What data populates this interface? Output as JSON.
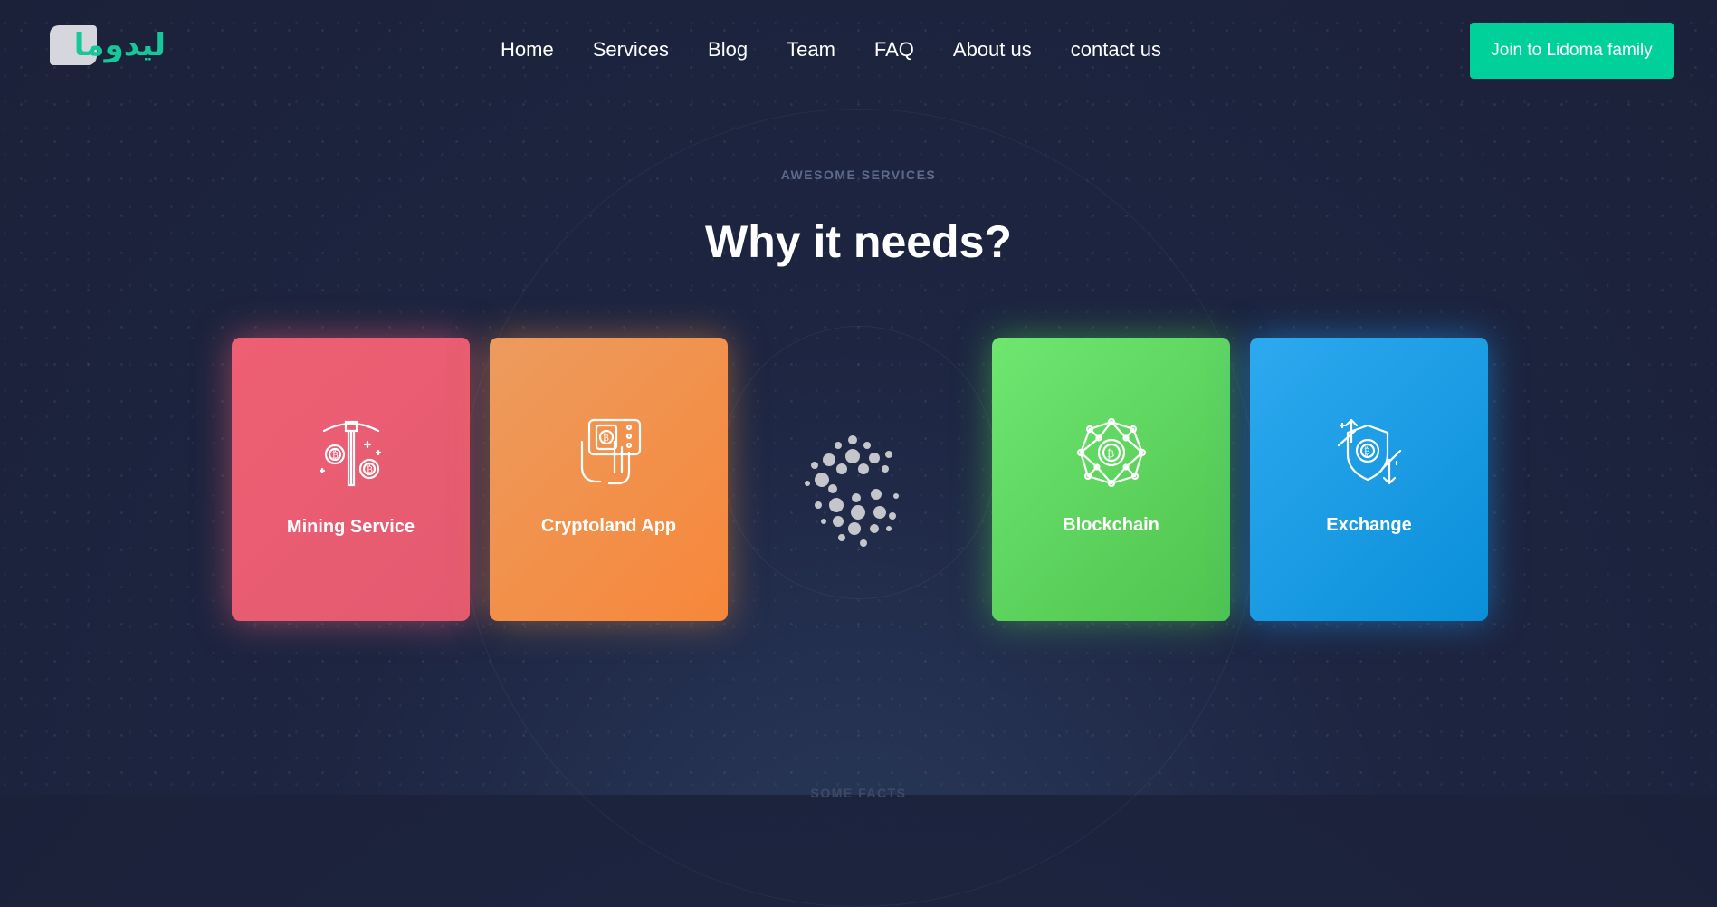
{
  "header": {
    "logo_text": "ليدوما",
    "nav": [
      "Home",
      "Services",
      "Blog",
      "Team",
      "FAQ",
      "About us",
      "contact us"
    ],
    "cta_label": "Join to Lidoma family"
  },
  "section": {
    "eyebrow": "AWESOME SERVICES",
    "title": "Why it needs?",
    "cards": [
      {
        "label": "Mining Service",
        "icon": "mining-pickaxe-bitcoin-icon",
        "color": "#ee5f73"
      },
      {
        "label": "Cryptoland App",
        "icon": "crypto-app-phone-icon",
        "color": "#f28a40"
      },
      {
        "label": "Blockchain",
        "icon": "blockchain-network-icon",
        "color": "#5ed65e"
      },
      {
        "label": "Exchange",
        "icon": "exchange-shield-icon",
        "color": "#1e9de6"
      }
    ],
    "center_icon": "cardano-logo-icon"
  },
  "footer": {
    "next_eyebrow": "SOME FACTS"
  },
  "colors": {
    "accent": "#00d19a",
    "background": "#1d2541"
  }
}
